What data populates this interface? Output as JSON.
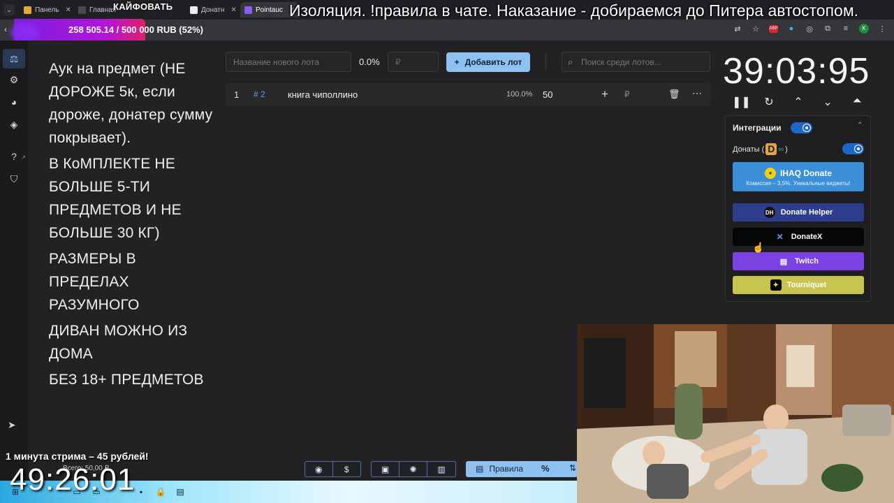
{
  "tabs": [
    {
      "label": "Панель",
      "favicon": "#e5a93b"
    },
    {
      "label": "Главная",
      "favicon": "#4a4a4a"
    },
    {
      "label": "Донатн",
      "favicon": "#eeeeee"
    },
    {
      "label": "Pointauc",
      "favicon": "#8b5cf6"
    }
  ],
  "overlay_title": "КАЙФОВАТЬ",
  "ticker": "Изоляция. !правила в чате. Наказание - добираемся до Питера автостопом.",
  "auction_progress": {
    "text": "258 505.14 / 500 000 RUB (52%)",
    "fraction": 0.52
  },
  "rules_text": [
    "Аук на предмет (НЕ ДОРОЖЕ 5к, если дороже, донатер сумму покрывает).",
    "В КоМПЛЕКТЕ НЕ БОЛЬШЕ 5-ТИ ПРЕДМЕТОВ И НЕ БОЛЬШЕ 30 КГ)",
    "РАЗМЕРЫ В ПРЕДЕЛАХ РАЗУМНОГО",
    "ДИВАН МОЖНО ИЗ ДОМА",
    "БЕЗ 18+ ПРЕДМЕТОВ"
  ],
  "lot_form": {
    "name_placeholder": "Название нового лота",
    "percent": "0.0%",
    "amount_placeholder": "₽",
    "add_button": "Добавить лот"
  },
  "search": {
    "placeholder": "Поиск среди лотов..."
  },
  "lots": [
    {
      "index": "1",
      "id": "# 2",
      "name": "книга чиполлино",
      "percent": "100.0%",
      "amount": "50",
      "currency": "₽"
    }
  ],
  "timer": "39:03:95",
  "integrations": {
    "title": "Интеграции",
    "donations_label": "Донаты (",
    "donations_close": ")",
    "services": [
      {
        "name": "IHAQ Donate",
        "subtitle": "Комиссия – 3,5%. Уникальные виджеты!"
      },
      {
        "name": "Donate Helper"
      },
      {
        "name": "DonateX"
      },
      {
        "name": "Twitch"
      },
      {
        "name": "Tourniquet"
      }
    ]
  },
  "bottom_toolbar": {
    "rules_label": "Правила",
    "percent_icon": "%"
  },
  "stream_overlay": {
    "rate": "1 минута стрима – 45 рублей!",
    "total": "Всего: 50,00 ₽",
    "timer": "49:26:01"
  },
  "colors": {
    "accent": "#8fc0f2",
    "progress": "#b115d8",
    "twitch": "#7b41e3",
    "tourniquet": "#c7c550",
    "ihaq": "#3a8fd8",
    "donate_helper": "#2f3d8f"
  }
}
